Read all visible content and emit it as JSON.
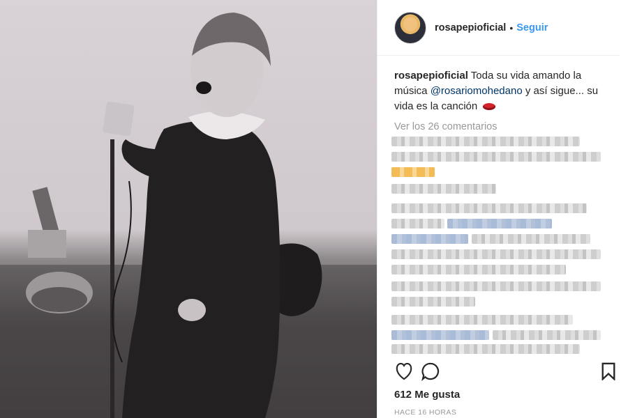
{
  "photo": {
    "alt": ""
  },
  "header": {
    "username": "rosapepioficial",
    "separator": "•",
    "follow_label": "Seguir"
  },
  "caption": {
    "username": "rosapepioficial",
    "text_before": "Toda su vida amando la música",
    "mention": "@rosariomohedano",
    "text_after": "y así sigue... su vida es la canción",
    "emoji": "lips-icon"
  },
  "comments": {
    "view_all_label": "Ver los 26 comentarios"
  },
  "actions": {
    "like_icon": "heart-icon",
    "comment_icon": "speech-bubble-icon",
    "save_icon": "bookmark-icon"
  },
  "likes": {
    "label": "612 Me gusta"
  },
  "timestamp": {
    "label": "HACE 16 HORAS"
  },
  "colors": {
    "link_blue": "#3897f0",
    "mention_blue": "#003569",
    "muted_gray": "#999999",
    "text": "#262626"
  }
}
